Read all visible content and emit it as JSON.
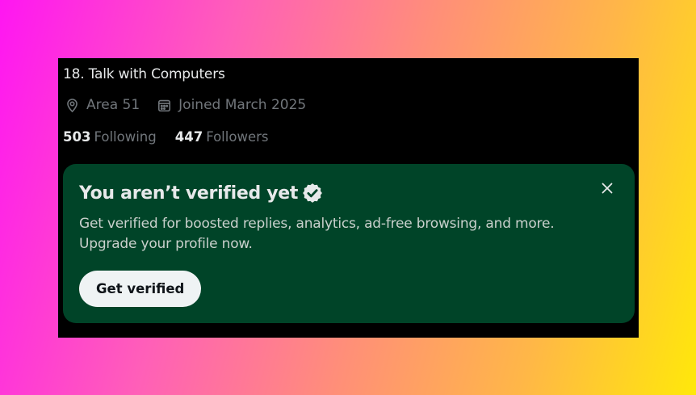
{
  "profile": {
    "bio": "18. Talk with Computers",
    "location": "Area 51",
    "location_icon": "map-pin-icon",
    "joined": "Joined March 2025",
    "joined_icon": "calendar-icon",
    "following_count": "503",
    "following_label": "Following",
    "followers_count": "447",
    "followers_label": "Followers"
  },
  "verify_card": {
    "title": "You aren’t verified yet",
    "badge_icon": "verified-badge-icon",
    "description": "Get verified for boosted replies, analytics, ad-free browsing, and more. Upgrade your profile now.",
    "button_label": "Get verified",
    "close_icon": "close-icon"
  },
  "colors": {
    "card_background": "#004428",
    "panel_background": "#000000",
    "button_background": "#eff3f4",
    "muted_text": "#71767b"
  }
}
